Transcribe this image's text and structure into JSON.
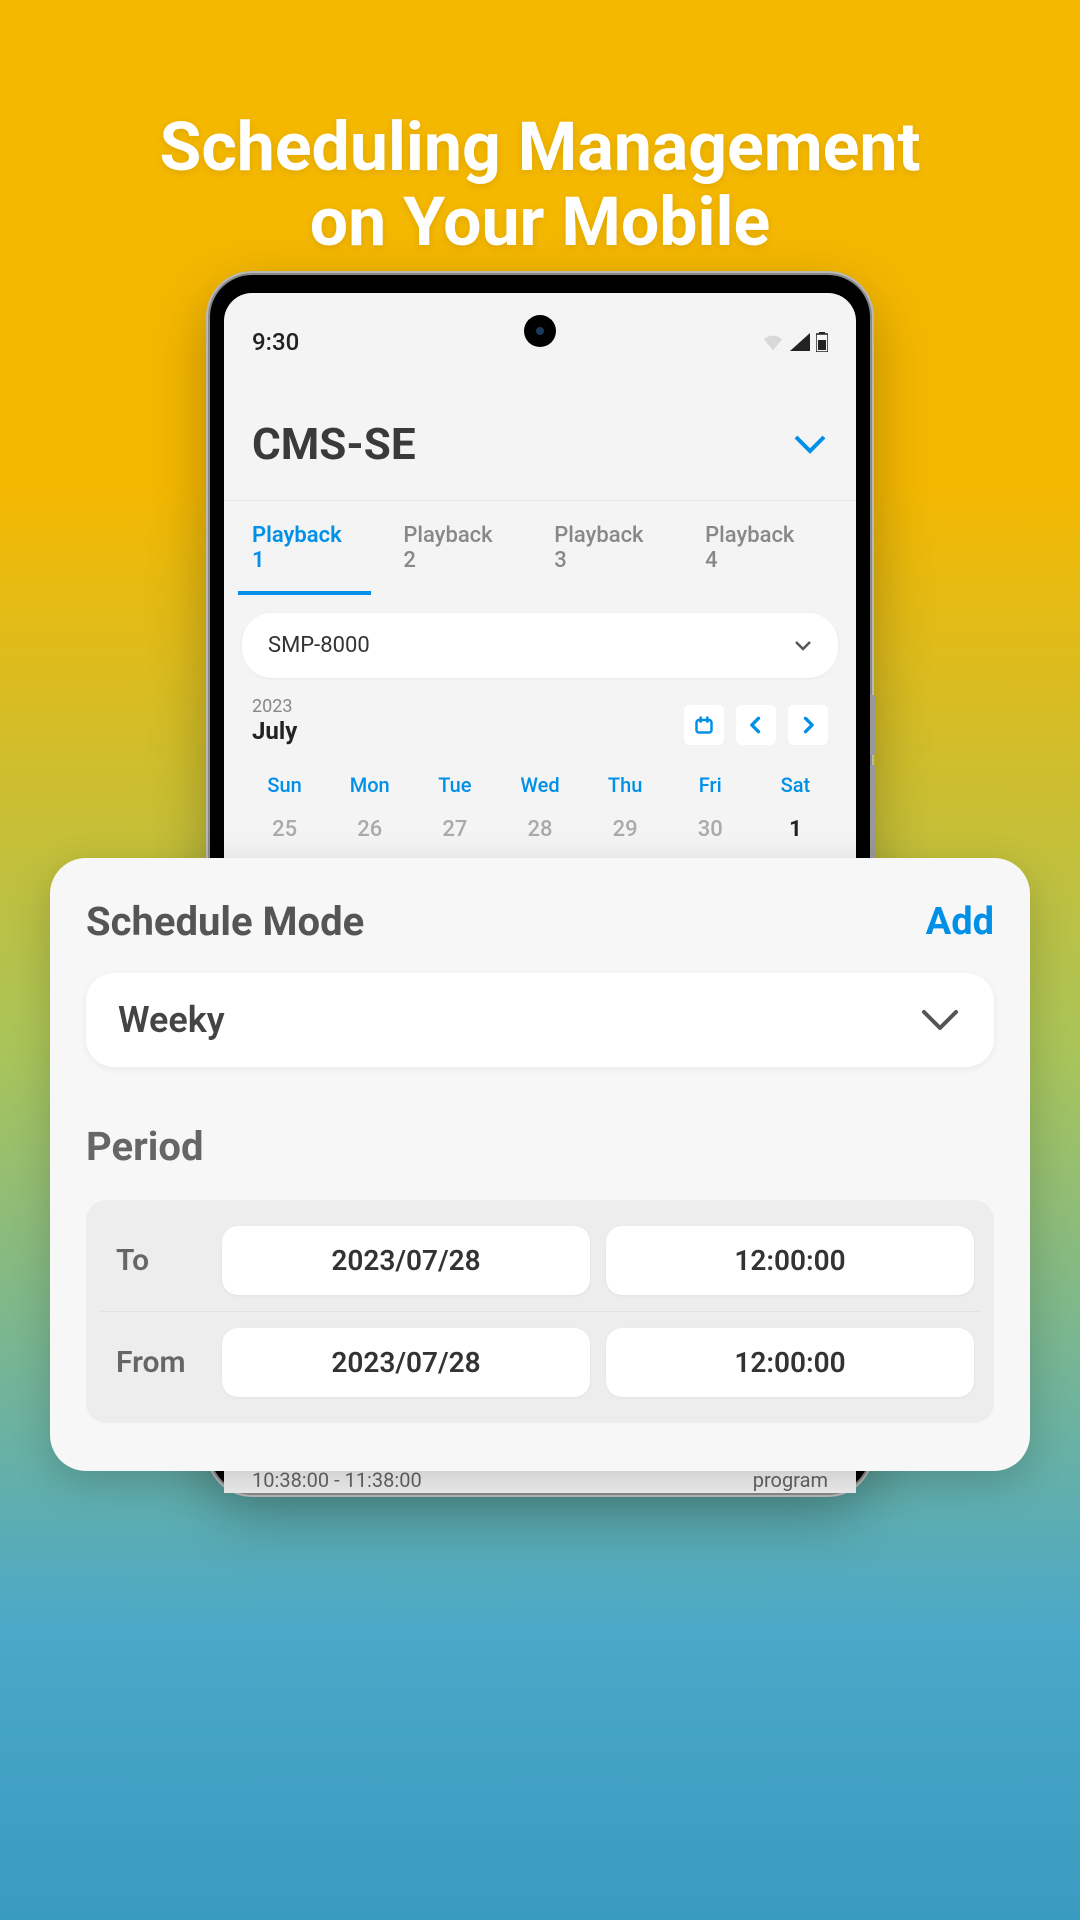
{
  "hero": {
    "line1": "Scheduling Management",
    "line2": "on Your Mobile"
  },
  "status": {
    "time": "9:30"
  },
  "header": {
    "title": "CMS-SE"
  },
  "tabs": [
    {
      "label": "Playback 1",
      "active": true
    },
    {
      "label": "Playback 2",
      "active": false
    },
    {
      "label": "Playback 3",
      "active": false
    },
    {
      "label": "Playback 4",
      "active": false
    }
  ],
  "device": {
    "selected": "SMP-8000"
  },
  "calendar": {
    "year": "2023",
    "month": "July",
    "dows": [
      "Sun",
      "Mon",
      "Tue",
      "Wed",
      "Thu",
      "Fri",
      "Sat"
    ],
    "days": [
      "25",
      "26",
      "27",
      "28",
      "29",
      "30",
      "1"
    ],
    "boldIndex": 6
  },
  "sheet": {
    "title": "Schedule Mode",
    "add": "Add",
    "mode": "Weeky",
    "periodTitle": "Period",
    "rows": [
      {
        "label": "To",
        "date": "2023/07/28",
        "time": "12:00:00"
      },
      {
        "label": "From",
        "date": "2023/07/28",
        "time": "12:00:00"
      }
    ]
  },
  "footer": {
    "timerange": "10:38:00 - 11:38:00",
    "right": "program"
  }
}
